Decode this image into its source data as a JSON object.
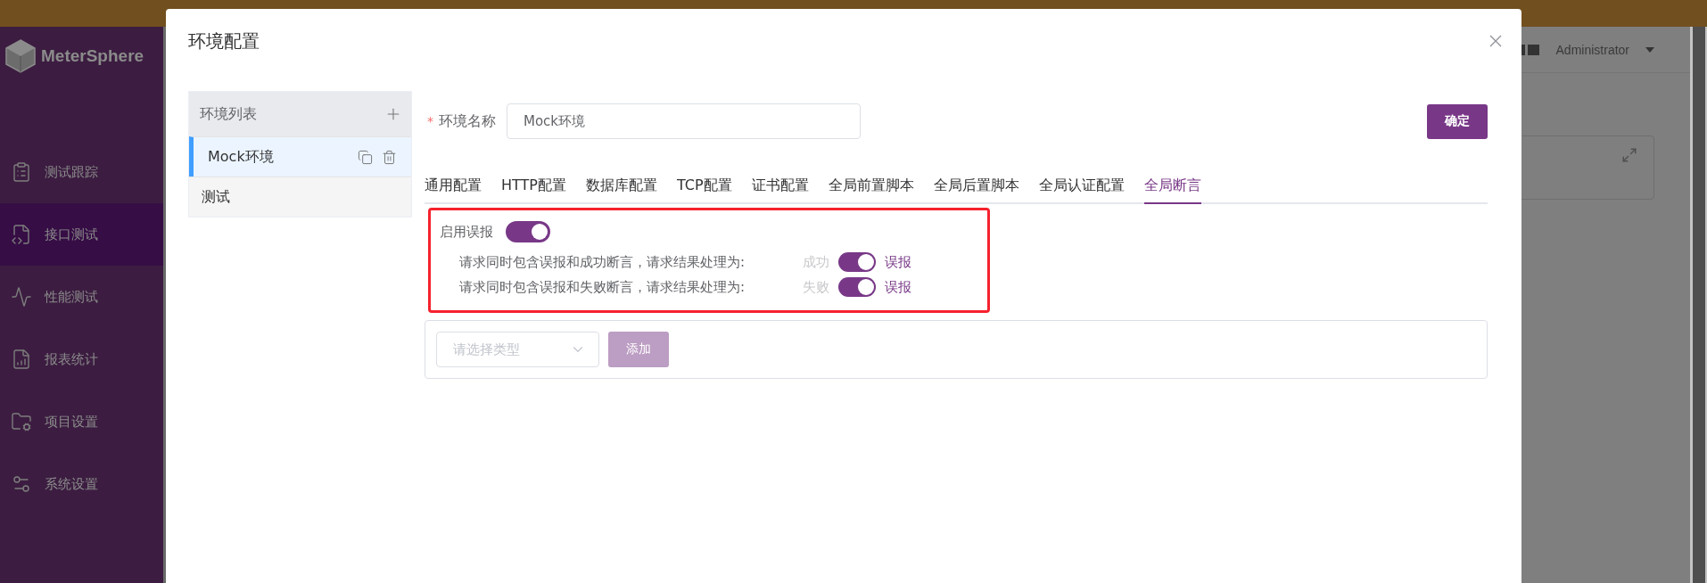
{
  "sidebar": {
    "brand": "MeterSphere",
    "items": [
      {
        "label": "测试跟踪",
        "selected": false
      },
      {
        "label": "接口测试",
        "selected": true
      },
      {
        "label": "性能测试",
        "selected": false
      },
      {
        "label": "报表统计",
        "selected": false
      },
      {
        "label": "项目设置",
        "selected": false
      },
      {
        "label": "系统设置",
        "selected": false
      }
    ]
  },
  "header": {
    "user": "Administrator"
  },
  "dialog": {
    "title": "环境配置",
    "env_list": {
      "title": "环境列表",
      "items": [
        {
          "name": "Mock环境",
          "selected": true
        },
        {
          "name": "测试",
          "selected": false
        }
      ]
    },
    "name_field": {
      "required_mark": "*",
      "label": "环境名称",
      "value": "Mock环境"
    },
    "confirm": "确定",
    "tabs": [
      {
        "label": "通用配置",
        "selected": false
      },
      {
        "label": "HTTP配置",
        "selected": false
      },
      {
        "label": "数据库配置",
        "selected": false
      },
      {
        "label": "TCP配置",
        "selected": false
      },
      {
        "label": "证书配置",
        "selected": false
      },
      {
        "label": "全局前置脚本",
        "selected": false
      },
      {
        "label": "全局后置脚本",
        "selected": false
      },
      {
        "label": "全局认证配置",
        "selected": false
      },
      {
        "label": "全局断言",
        "selected": true
      }
    ],
    "false_alarm": {
      "label": "启用误报",
      "on": true,
      "highlight": true,
      "rules": [
        {
          "text": "请求同时包含误报和成功断言，请求结果处理为:",
          "off_label": "成功",
          "on_label": "误报",
          "on": true
        },
        {
          "text": "请求同时包含误报和失败断言，请求结果处理为:",
          "off_label": "失败",
          "on_label": "误报",
          "on": true
        }
      ]
    },
    "assertion": {
      "placeholder": "请选择类型",
      "add": "添加",
      "add_disabled": true
    }
  }
}
